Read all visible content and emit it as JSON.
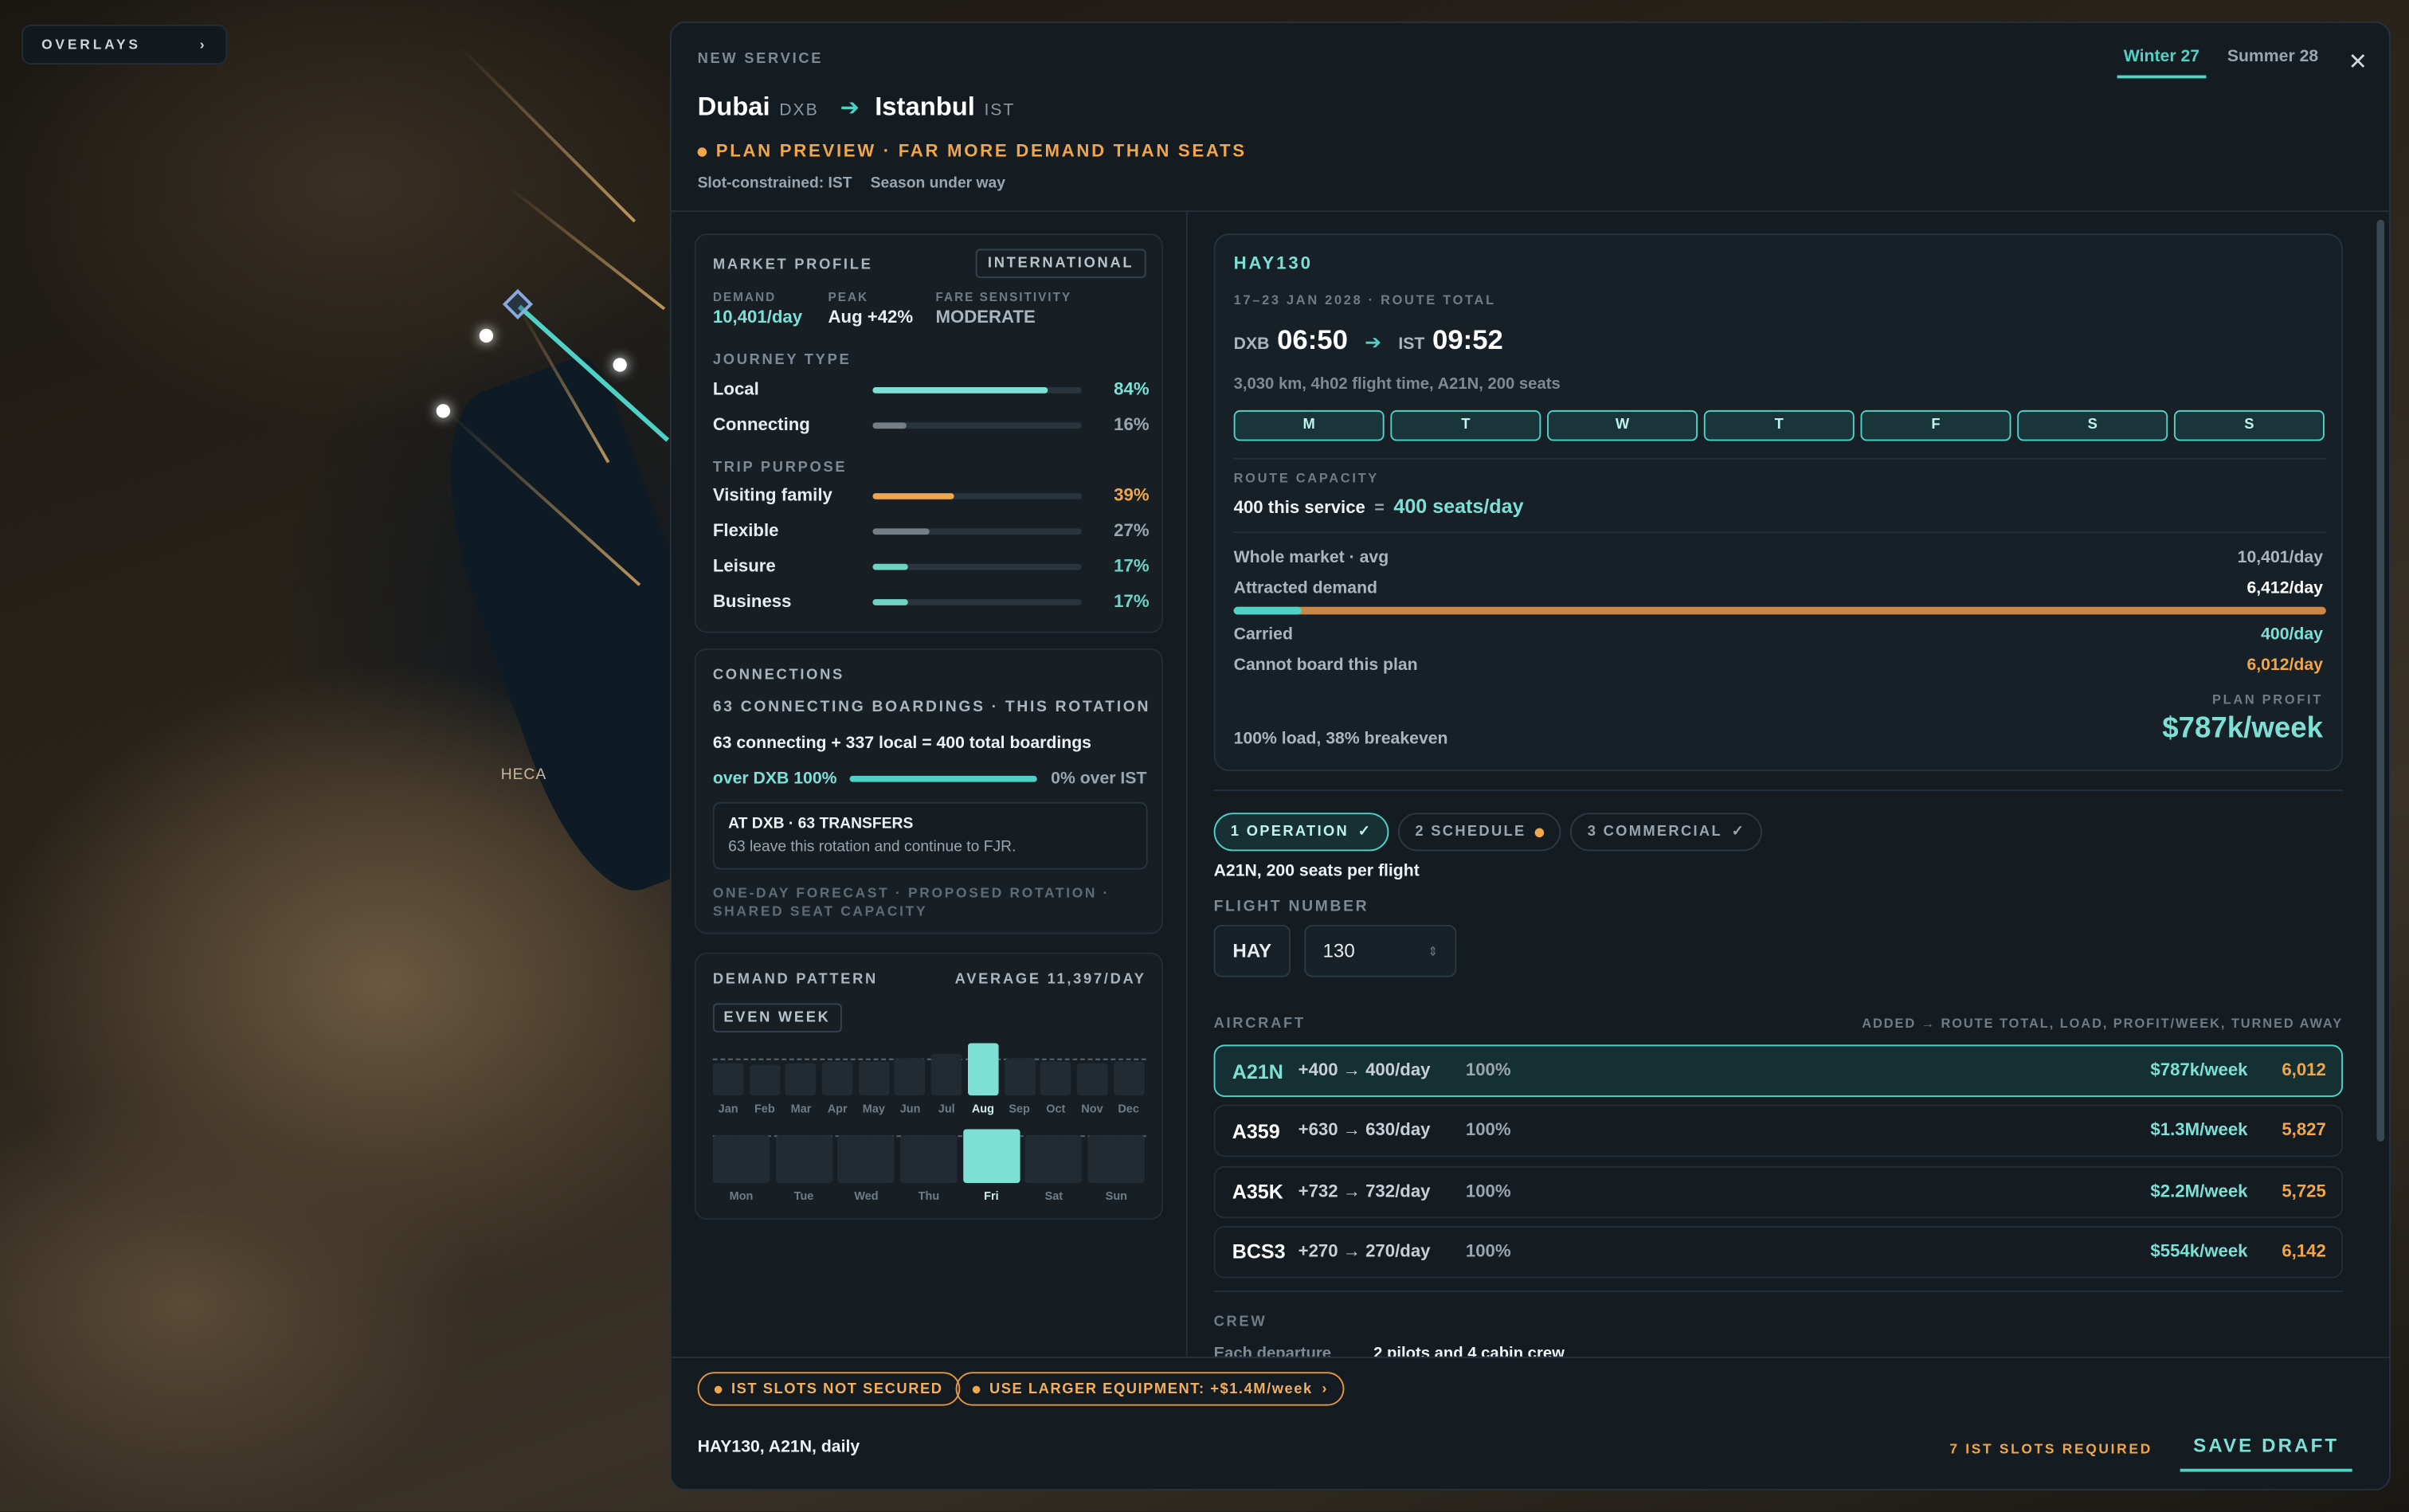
{
  "overlays_label": "OVERLAYS",
  "map_label": "HECA",
  "header": {
    "new_service": "NEW SERVICE",
    "origin_city": "Dubai",
    "origin_code": "DXB",
    "dest_city": "Istanbul",
    "dest_code": "IST",
    "plan_preview": "PLAN PREVIEW · FAR MORE DEMAND THAN SEATS",
    "meta1": "Slot-constrained: IST",
    "meta2": "Season under way",
    "tabs": [
      "Winter 27",
      "Summer 28"
    ]
  },
  "market": {
    "title": "MARKET PROFILE",
    "badge": "INTERNATIONAL",
    "demand_k": "DEMAND",
    "demand_v": "10,401/day",
    "peak_k": "PEAK",
    "peak_v": "Aug +42%",
    "fare_k": "FARE SENSITIVITY",
    "fare_v": "MODERATE",
    "journey_title": "JOURNEY TYPE",
    "journey": [
      {
        "name": "Local",
        "pct": "84%",
        "v": 84
      },
      {
        "name": "Connecting",
        "pct": "16%",
        "v": 16
      }
    ],
    "purpose_title": "TRIP PURPOSE",
    "purpose": [
      {
        "name": "Visiting family",
        "pct": "39%",
        "v": 39
      },
      {
        "name": "Flexible",
        "pct": "27%",
        "v": 27
      },
      {
        "name": "Leisure",
        "pct": "17%",
        "v": 17
      },
      {
        "name": "Business",
        "pct": "17%",
        "v": 17
      }
    ]
  },
  "connections": {
    "title": "CONNECTIONS",
    "sub": "63 CONNECTING BOARDINGS · THIS ROTATION",
    "line": "63 connecting + 337 local = 400 total boardings",
    "over_dxb": "over DXB 100%",
    "over_ist": "0% over IST",
    "box_title": "AT DXB · 63 TRANSFERS",
    "box_text": "63 leave this rotation and continue to FJR.",
    "note": "ONE-DAY FORECAST · PROPOSED ROTATION · SHARED SEAT CAPACITY"
  },
  "pattern": {
    "title": "DEMAND PATTERN",
    "avg": "AVERAGE 11,397/day",
    "toggle": "EVEN WEEK",
    "months": [
      "Jan",
      "Feb",
      "Mar",
      "Apr",
      "May",
      "Jun",
      "Jul",
      "Aug",
      "Sep",
      "Oct",
      "Nov",
      "Dec"
    ],
    "month_vals": [
      0.62,
      0.6,
      0.62,
      0.64,
      0.66,
      0.7,
      0.78,
      1.0,
      0.72,
      0.66,
      0.62,
      0.64
    ],
    "days": [
      "Mon",
      "Tue",
      "Wed",
      "Thu",
      "Fri",
      "Sat",
      "Sun"
    ],
    "day_vals": [
      0.88,
      0.88,
      0.88,
      0.88,
      1.0,
      0.88,
      0.88
    ]
  },
  "flight": {
    "id": "HAY130",
    "dates": "17–23 JAN 2028 · ROUTE TOTAL",
    "dep_code": "DXB",
    "dep_time": "06:50",
    "arr_code": "IST",
    "arr_time": "09:52",
    "info": "3,030 km, 4h02 flight time, A21N, 200 seats",
    "days": [
      "M",
      "T",
      "W",
      "T",
      "F",
      "S",
      "S"
    ],
    "cap_title": "ROUTE CAPACITY",
    "cap_service": "400 this service",
    "cap_eq": "=",
    "cap_total": "400 seats/day",
    "whole_k": "Whole market · avg",
    "whole_v": "10,401/day",
    "attr_k": "Attracted demand",
    "attr_v": "6,412/day",
    "carried_k": "Carried",
    "carried_v": "400/day",
    "cannot_k": "Cannot board this plan",
    "cannot_v": "6,012/day",
    "profit_k": "PLAN PROFIT",
    "profit_v": "$787k/week",
    "load": "100% load, 38% breakeven"
  },
  "steps": [
    "1 OPERATION",
    "2 SCHEDULE",
    "3 COMMERCIAL"
  ],
  "operation": {
    "seats": "A21N, 200 seats per flight",
    "fn_title": "FLIGHT NUMBER",
    "fn_prefix": "HAY",
    "fn_num": "130",
    "ac_title": "AIRCRAFT",
    "ac_hint": "ADDED → ROUTE TOTAL, LOAD, PROFIT/WEEK, TURNED AWAY",
    "aircraft": [
      {
        "code": "A21N",
        "delta": "+400 → 400/day",
        "load": "100%",
        "profit": "$787k/week",
        "turned": "6,012"
      },
      {
        "code": "A359",
        "delta": "+630 → 630/day",
        "load": "100%",
        "profit": "$1.3M/week",
        "turned": "5,827"
      },
      {
        "code": "A35K",
        "delta": "+732 → 732/day",
        "load": "100%",
        "profit": "$2.2M/week",
        "turned": "5,725"
      },
      {
        "code": "BCS3",
        "delta": "+270 → 270/day",
        "load": "100%",
        "profit": "$554k/week",
        "turned": "6,142"
      }
    ],
    "crew_title": "CREW",
    "crew_k": "Each departure",
    "crew_v": "2 pilots and 4 cabin crew"
  },
  "footer": {
    "pill1": "IST SLOTS NOT SECURED",
    "pill2": "USE LARGER EQUIPMENT: +$1.4M/week",
    "summary": "HAY130, A21N, daily",
    "slots": "7 IST SLOTS REQUIRED",
    "save": "SAVE DRAFT"
  },
  "colors": {
    "accent": "#4fd1c5",
    "warn": "#f0a64a"
  }
}
